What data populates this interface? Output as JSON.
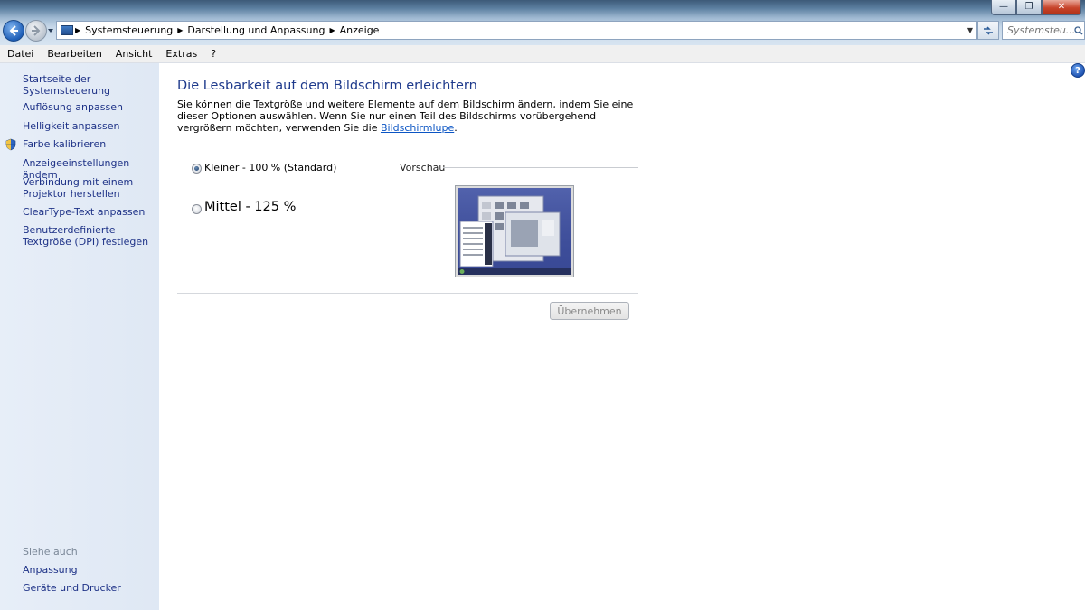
{
  "window": {
    "minimize_glyph": "—",
    "restore_glyph": "❐",
    "close_glyph": "✕"
  },
  "address_bar": {
    "breadcrumbs": [
      "Systemsteuerung",
      "Darstellung und Anpassung",
      "Anzeige"
    ],
    "search_placeholder": "Systemsteu..."
  },
  "menu": [
    "Datei",
    "Bearbeiten",
    "Ansicht",
    "Extras",
    "?"
  ],
  "sidebar": {
    "home": "Startseite der Systemsteuerung",
    "links": [
      "Auflösung anpassen",
      "Helligkeit anpassen",
      "Farbe kalibrieren",
      "Anzeigeeinstellungen ändern",
      "Verbindung mit einem Projektor herstellen",
      "ClearType-Text anpassen",
      "Benutzerdefinierte Textgröße (DPI) festlegen"
    ],
    "see_also_heading": "Siehe auch",
    "see_also": [
      "Anpassung",
      "Geräte und Drucker"
    ]
  },
  "main": {
    "title": "Die Lesbarkeit auf dem Bildschirm erleichtern",
    "description": "Sie können die Textgröße und weitere Elemente auf dem Bildschirm ändern, indem Sie eine dieser Optionen auswählen. Wenn Sie nur einen Teil des Bildschirms vorübergehend vergrößern möchten, verwenden Sie die ",
    "magnifier_link": "Bildschirmlupe",
    "description_end": ".",
    "options": [
      {
        "label": "Kleiner - 100 % (Standard)",
        "selected": true
      },
      {
        "label": "Mittel - 125 %",
        "selected": false
      }
    ],
    "preview_label": "Vorschau",
    "apply_button": "Übernehmen",
    "help_glyph": "?"
  },
  "colors": {
    "link": "#1e3287",
    "title": "#1e3a8c",
    "sidebar_bg": "#e3ebf6"
  }
}
